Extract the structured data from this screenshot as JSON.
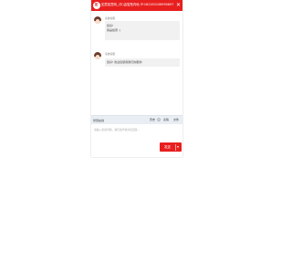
{
  "window": {
    "title": "如意如意网_(中)由智慧内地 IP:1621E0156990697 ▾",
    "logo_text": "如",
    "close_glyph": "✕"
  },
  "messages": [
    {
      "sender": "系统客服",
      "lines": [
        "您好!",
        "我是如意 :)"
      ]
    },
    {
      "sender": "系统客服",
      "lines": [
        "您好! 欢迎您使用我们的服务!"
      ]
    }
  ],
  "toolbar": {
    "left_label": "智慧在线",
    "item_history": "历史",
    "item_emoji": "表情",
    "item_files": "文件"
  },
  "input": {
    "placeholder": "请输入您的问题，我们会尽快为您回答..."
  },
  "send_button": {
    "label": "发送"
  },
  "colors": {
    "brand": "#e81f1f",
    "toolbar_bg": "#e9eef4"
  }
}
